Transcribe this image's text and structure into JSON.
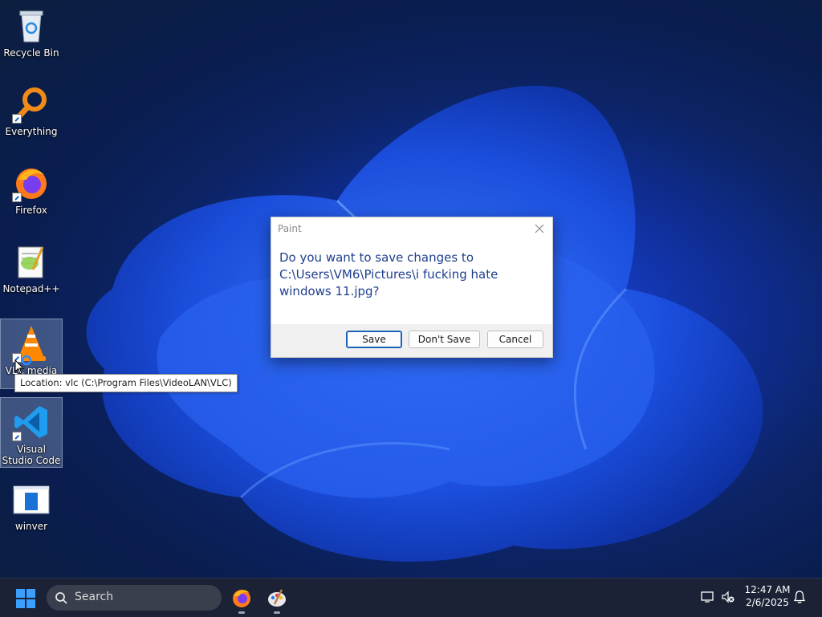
{
  "desktop": {
    "icons": [
      {
        "label": "Recycle Bin",
        "icon": "recycle-bin-icon"
      },
      {
        "label": "Everything",
        "icon": "everything-search-icon"
      },
      {
        "label": "Firefox",
        "icon": "firefox-icon"
      },
      {
        "label": "Notepad++",
        "icon": "notepad-plus-plus-icon"
      },
      {
        "label": "VLC media",
        "icon": "vlc-icon"
      },
      {
        "label": "Visual Studio Code",
        "icon": "vscode-icon"
      },
      {
        "label": "winver",
        "icon": "winver-icon"
      }
    ],
    "tooltip": "Location: vlc (C:\\Program Files\\VideoLAN\\VLC)"
  },
  "dialog": {
    "title": "Paint",
    "message": "Do you want to save changes to C:\\Users\\VM6\\Pictures\\i fucking hate windows 11.jpg?",
    "buttons": {
      "save": "Save",
      "dont_save": "Don't Save",
      "cancel": "Cancel"
    }
  },
  "taskbar": {
    "search_placeholder": "Search",
    "pinned_apps": [
      "firefox-icon",
      "paint-icon"
    ],
    "tray": {
      "time": "12:47 AM",
      "date": "2/6/2025"
    }
  },
  "colors": {
    "accent": "#1e63b8",
    "dialog_text": "#1e3f8f",
    "taskbar_bg": "#1b2235"
  }
}
